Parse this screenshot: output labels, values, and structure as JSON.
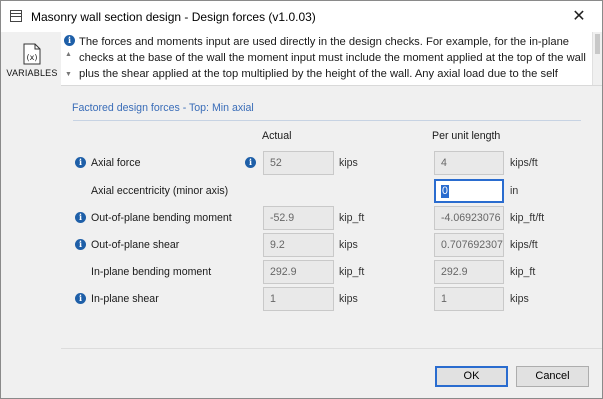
{
  "window": {
    "title": "Masonry wall section design - Design forces (v1.0.03)",
    "close_glyph": "✕"
  },
  "sidebar": {
    "variables_label": "VARIABLES",
    "variables_icon": "variables-icon"
  },
  "banner": {
    "text": "The forces and moments input are used directly in the design checks. For example, for the in-plane checks at the base of the wall the moment input must include the moment applied at the top of the wall plus the shear applied at the top multiplied by the height of the wall. Any axial load due to the self weight of the wall should be included in the axial force value."
  },
  "section": {
    "title": "Factored design forces - Top: Min axial"
  },
  "columns": {
    "actual": "Actual",
    "per_unit": "Per unit length"
  },
  "rows": [
    {
      "label": "Axial force",
      "actual": "52",
      "actual_unit": "kips",
      "per_unit": "4",
      "per_unit_unit": "kips/ft"
    },
    {
      "label": "Axial eccentricity (minor axis)",
      "per_unit": "0",
      "per_unit_unit": "in"
    },
    {
      "label": "Out-of-plane bending moment",
      "actual": "-52.9",
      "actual_unit": "kip_ft",
      "per_unit": "-4.06923076",
      "per_unit_unit": "kip_ft/ft"
    },
    {
      "label": "Out-of-plane shear",
      "actual": "9.2",
      "actual_unit": "kips",
      "per_unit": "0.707692307",
      "per_unit_unit": "kips/ft"
    },
    {
      "label": "In-plane bending moment",
      "actual": "292.9",
      "actual_unit": "kip_ft",
      "per_unit": "292.9",
      "per_unit_unit": "kip_ft"
    },
    {
      "label": "In-plane shear",
      "actual": "1",
      "actual_unit": "kips",
      "per_unit": "1",
      "per_unit_unit": "kips"
    }
  ],
  "info_glyph": "i",
  "buttons": {
    "ok": "OK",
    "cancel": "Cancel"
  },
  "colors": {
    "accent": "#2a6ccf",
    "info": "#1e5fa8",
    "section_title": "#3a6db8"
  }
}
